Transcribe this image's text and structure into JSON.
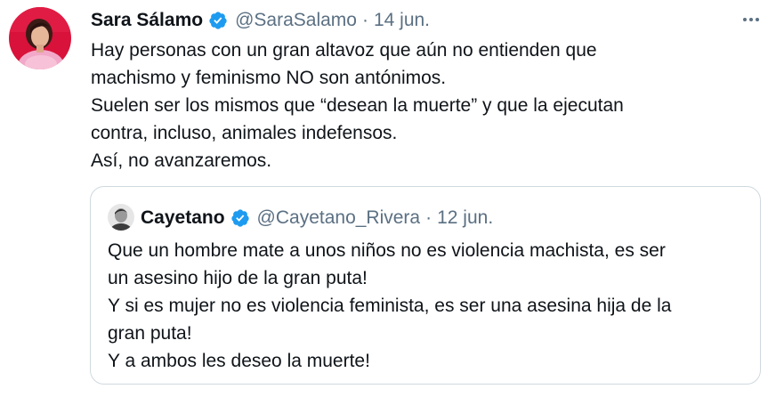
{
  "tweet": {
    "author_name": "Sara Sálamo",
    "handle": "@SaraSalamo",
    "separator": "·",
    "date": "14 jun.",
    "avatar_icon": "profile-photo-avatar",
    "verified_icon": "verified-badge-icon",
    "more_icon": "more-options-icon",
    "text_lines": [
      "Hay personas con un gran altavoz que aún no entienden que",
      "machismo y feminismo NO son antónimos.",
      "Suelen ser los mismos que “desean la muerte” y que la ejecutan",
      "contra, incluso, animales indefensos.",
      "Así, no avanzaremos."
    ]
  },
  "quoted_tweet": {
    "author_name": "Cayetano",
    "handle": "@Cayetano_Rivera",
    "separator": "·",
    "date": "12 jun.",
    "avatar_icon": "profile-photo-avatar",
    "verified_icon": "verified-badge-icon",
    "text_lines": [
      "Que un hombre mate a unos niños no es violencia machista, es ser",
      "un asesino hijo de la gran puta!",
      "Y si es mujer no es violencia feminista, es ser una asesina hija de la",
      "gran puta!",
      "Y a ambos les deseo la muerte!"
    ]
  },
  "colors": {
    "text_primary": "#0f1419",
    "text_secondary": "#5b7083",
    "verified_blue": "#1d9bf0",
    "border": "#cfd9de",
    "avatar_background": "#d8123a"
  }
}
